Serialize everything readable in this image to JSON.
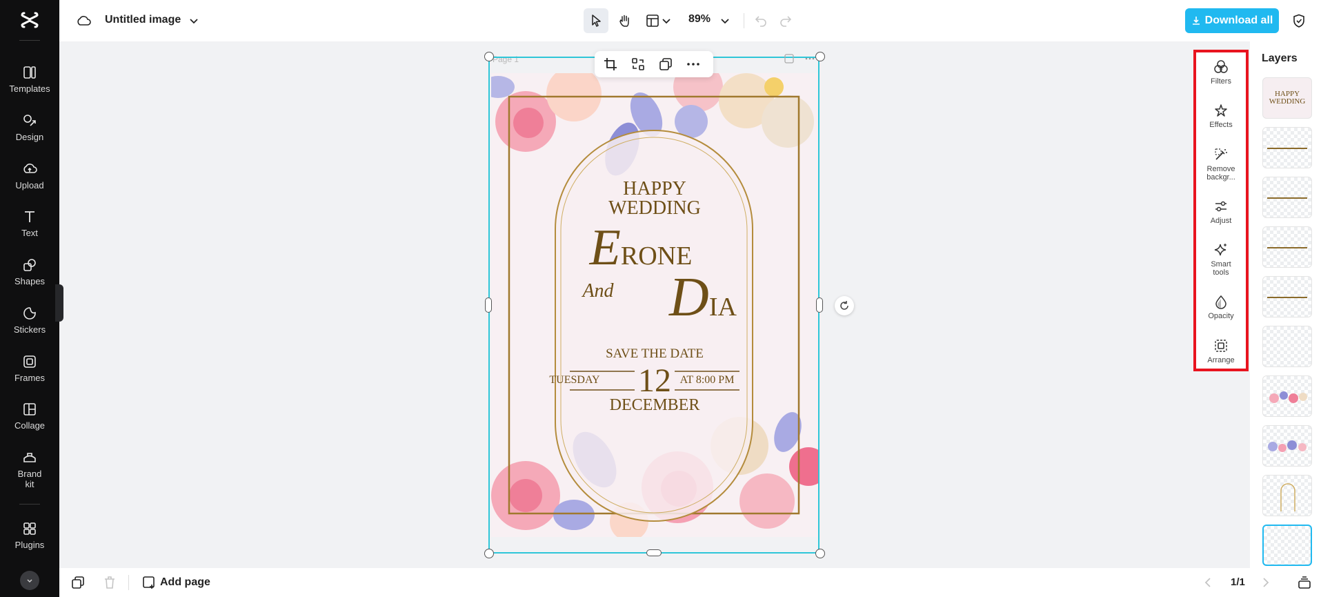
{
  "sidebar": {
    "items": [
      {
        "label": "Templates",
        "icon": "templates-icon"
      },
      {
        "label": "Design",
        "icon": "design-icon"
      },
      {
        "label": "Upload",
        "icon": "upload-icon"
      },
      {
        "label": "Text",
        "icon": "text-icon"
      },
      {
        "label": "Shapes",
        "icon": "shapes-icon"
      },
      {
        "label": "Stickers",
        "icon": "stickers-icon"
      },
      {
        "label": "Frames",
        "icon": "frames-icon"
      },
      {
        "label": "Collage",
        "icon": "collage-icon"
      },
      {
        "label": "Brand kit",
        "icon": "brand-kit-icon"
      },
      {
        "label": "Plugins",
        "icon": "plugins-icon"
      }
    ]
  },
  "header": {
    "title": "Untitled image",
    "zoom": "89%",
    "download_label": "Download all"
  },
  "canvas": {
    "page_label": "Page 1",
    "invite": {
      "line1": "HAPPY",
      "line2": "WEDDING",
      "name1_initial": "E",
      "name1_rest": "RONE",
      "connector": "And",
      "name2_initial": "D",
      "name2_rest": "IA",
      "save_date": "SAVE THE DATE",
      "weekday": "TUESDAY",
      "day": "12",
      "time": "AT 8:00 PM",
      "month": "DECEMBER"
    }
  },
  "tools": {
    "items": [
      {
        "label": "Filters",
        "icon": "filters-icon"
      },
      {
        "label": "Effects",
        "icon": "effects-icon"
      },
      {
        "label": "Remove backgr...",
        "icon": "remove-background-icon"
      },
      {
        "label": "Adjust",
        "icon": "adjust-icon"
      },
      {
        "label": "Smart tools",
        "icon": "smart-tools-icon"
      },
      {
        "label": "Opacity",
        "icon": "opacity-icon"
      },
      {
        "label": "Arrange",
        "icon": "arrange-icon"
      }
    ]
  },
  "layers": {
    "title": "Layers",
    "thumb_text": "HAPPY WEDDING"
  },
  "footer": {
    "add_page_label": "Add page",
    "page_count": "1/1"
  },
  "colors": {
    "accent": "#20b9f0",
    "selection": "#2ec6d8",
    "highlight": "#e8141f",
    "gold": "#6e4f17"
  }
}
